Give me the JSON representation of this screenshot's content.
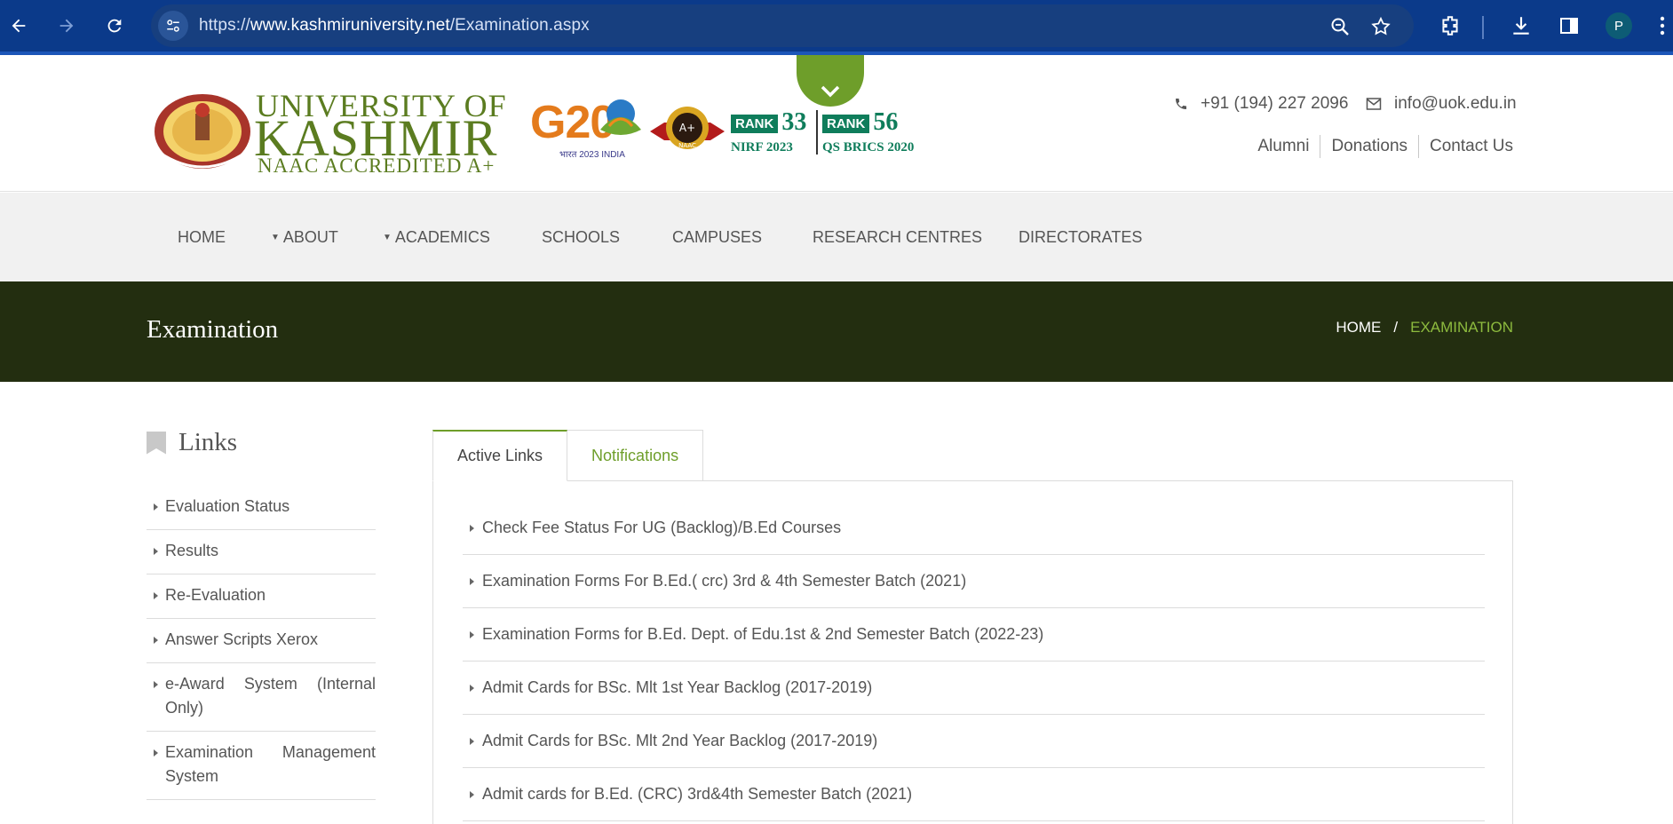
{
  "browser": {
    "url_prefix": "https://",
    "url_domain": "www.kashmiruniversity.net",
    "url_path": "/Examination.aspx",
    "profile_initial": "P"
  },
  "header": {
    "logo_line1": "UNIVERSITY OF",
    "logo_line2": "KASHMIR",
    "logo_line3": "NAAC ACCREDITED A+",
    "g20": "G20",
    "g20_sub": "भारत 2023 INDIA",
    "rank1_badge": "RANK",
    "rank1_num": "33",
    "rank1_sub": "NIRF 2023",
    "rank2_badge": "RANK",
    "rank2_num": "56",
    "rank2_sub": "QS BRICS 2020",
    "phone": "+91 (194) 227 2096",
    "email": "info@uok.edu.in",
    "top_links": [
      "Alumni",
      "Donations",
      "Contact Us"
    ]
  },
  "nav": {
    "items": [
      "HOME",
      "ABOUT",
      "ACADEMICS",
      "SCHOOLS",
      "CAMPUSES",
      "RESEARCH CENTRES",
      "DIRECTORATES"
    ]
  },
  "title_bar": {
    "title": "Examination",
    "crumb_home": "HOME",
    "crumb_sep": "/",
    "crumb_current": "EXAMINATION"
  },
  "sidebar": {
    "title": "Links",
    "items": [
      "Evaluation Status",
      "Results",
      "Re-Evaluation",
      "Answer Scripts Xerox",
      "e-Award System (Internal Only)",
      "Examination Management System"
    ]
  },
  "tabs": [
    "Active Links",
    "Notifications"
  ],
  "content": {
    "items": [
      "Check Fee Status For UG (Backlog)/B.Ed Courses",
      "Examination Forms For B.Ed.( crc) 3rd & 4th Semester Batch (2021)",
      "Examination Forms for B.Ed. Dept. of Edu.1st & 2nd Semester Batch (2022-23)",
      "Admit Cards for BSc. Mlt 1st Year Backlog (2017-2019)",
      "Admit Cards for BSc. Mlt 2nd Year Backlog (2017-2019)",
      "Admit cards for B.Ed. (CRC) 3rd&4th Semester Batch (2021)"
    ]
  },
  "colors": {
    "chrome": "#0b3a8a",
    "accent_green": "#6e9e2a",
    "title_bar": "#232e10"
  }
}
